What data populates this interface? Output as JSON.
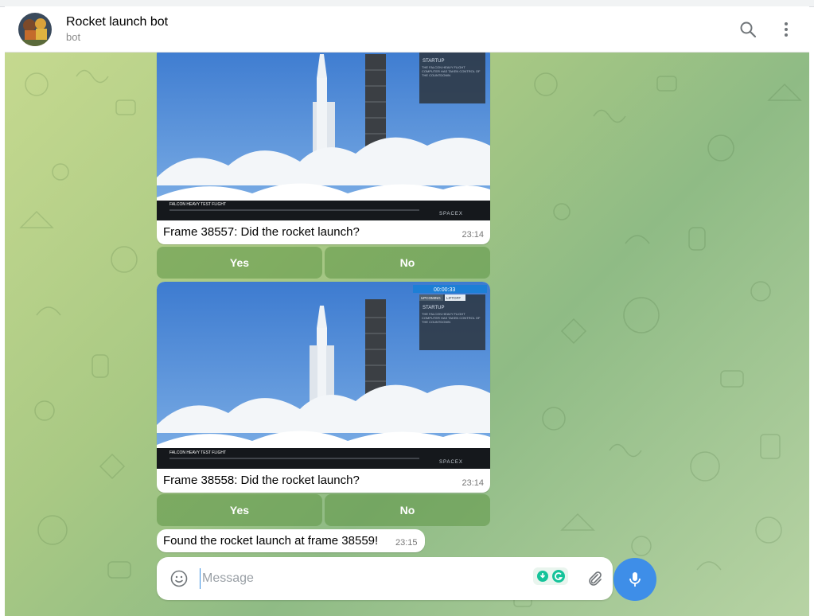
{
  "header": {
    "title": "Rocket launch bot",
    "subtitle": "bot",
    "search_icon": "search-icon",
    "menu_icon": "more-vert-icon"
  },
  "messages": [
    {
      "photo_overlay": {
        "status_title": "STARTUP",
        "status_text": "THE FALCON HEAVY FLIGHT COMPUTER HAS TAKEN CONTROL OF THE COUNTDOWN",
        "flight_banner": "FALCON HEAVY TEST FLIGHT",
        "brand": "SPACEX"
      },
      "caption": "Frame 38557: Did the rocket launch?",
      "time": "23:14",
      "buttons": [
        "Yes",
        "No"
      ]
    },
    {
      "photo_overlay": {
        "clock": "00:00:33",
        "tag_upcoming": "UPCOMING",
        "tag_liftoff": "LIFTOFF",
        "status_title": "STARTUP",
        "status_text": "THE FALCON HEAVY FLIGHT COMPUTER HAS TAKEN CONTROL OF THE COUNTDOWN",
        "flight_banner": "FALCON HEAVY TEST FLIGHT",
        "brand": "SPACEX"
      },
      "caption": "Frame 38558: Did the rocket launch?",
      "time": "23:14",
      "buttons": [
        "Yes",
        "No"
      ]
    }
  ],
  "final_message": {
    "text": "Found the rocket launch at frame 38559!",
    "time": "23:15"
  },
  "composer": {
    "placeholder": "Message",
    "emoji_icon": "emoji-icon",
    "grammarly_icon": "grammarly-icon",
    "attach_icon": "paperclip-icon",
    "mic_icon": "microphone-icon"
  },
  "colors": {
    "accent": "#3e8ee8",
    "keyboard_button": "#6f9b56",
    "sky": "#4a86d6"
  }
}
